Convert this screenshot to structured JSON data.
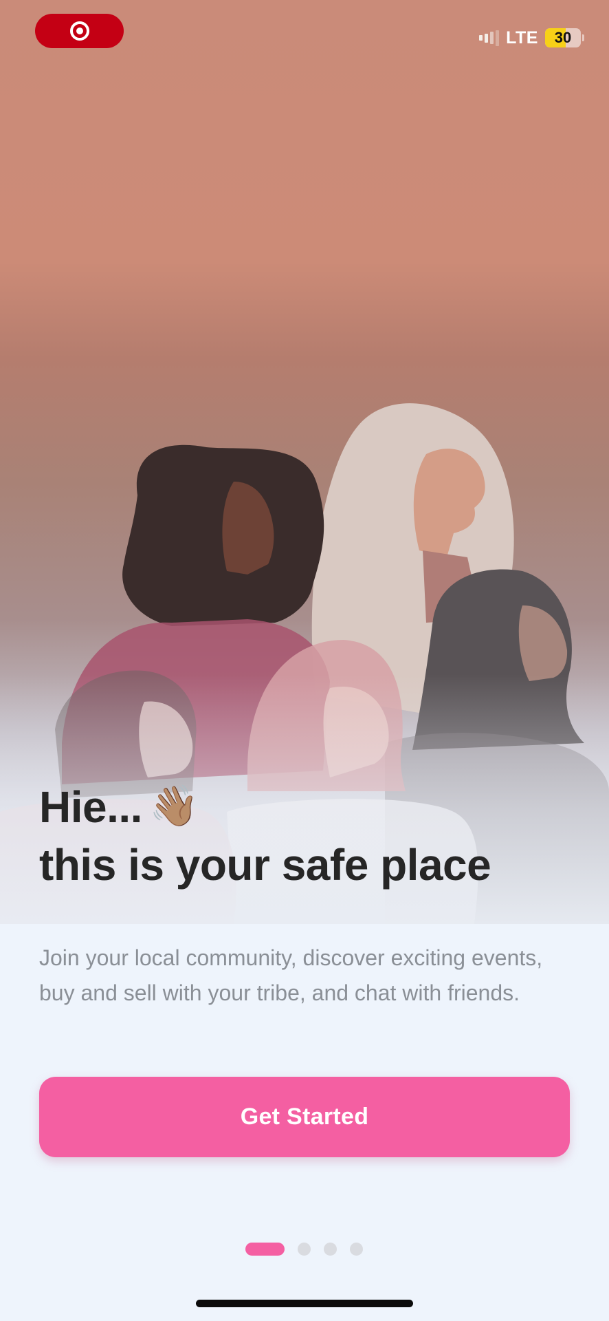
{
  "status_bar": {
    "record_icon": "screen-record-icon",
    "network": "LTE",
    "battery_level": "30",
    "battery_charging_icon": "bolt-icon"
  },
  "hero": {
    "illustration": "group-of-women-illustration"
  },
  "onboarding": {
    "headline_line1": "Hie...",
    "wave_emoji": "👋🏽",
    "headline_line2": "this is your safe place",
    "subtitle": "Join your local community, discover exciting events, buy and sell with your tribe, and chat with friends.",
    "cta_label": "Get Started"
  },
  "pager": {
    "page_count": 4,
    "current_page": 1
  },
  "colors": {
    "accent": "#f45fa2",
    "record_pill": "#c40014",
    "background": "#eef4fc"
  }
}
